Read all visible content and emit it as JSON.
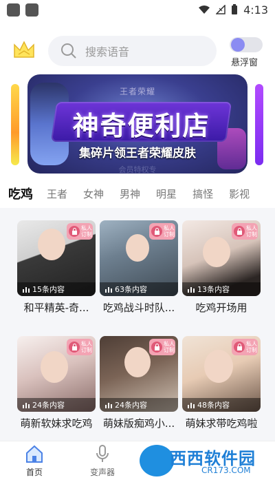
{
  "statusbar": {
    "time": "4:13"
  },
  "header": {
    "search_placeholder": "搜索语音",
    "float_label": "悬浮窗"
  },
  "banner": {
    "top_text": "王者荣耀",
    "title": "神奇便利店",
    "subtitle": "集碎片领王者荣耀皮肤",
    "bottom_text": "会员特权专"
  },
  "tabs": [
    {
      "label": "吃鸡"
    },
    {
      "label": "王者"
    },
    {
      "label": "女神"
    },
    {
      "label": "男神"
    },
    {
      "label": "明星"
    },
    {
      "label": "搞怪"
    },
    {
      "label": "影视"
    }
  ],
  "cards": [
    {
      "title": "和平精英-奇...",
      "count": "15条内容",
      "lock": "私人订制"
    },
    {
      "title": "吃鸡战斗时队...",
      "count": "63条内容",
      "lock": "私人订制"
    },
    {
      "title": "吃鸡开场用",
      "count": "13条内容",
      "lock": "私人订制"
    },
    {
      "title": "萌新软妹求吃鸡",
      "count": "24条内容",
      "lock": "私人订制"
    },
    {
      "title": "萌妹版痴鸡小...",
      "count": "24条内容",
      "lock": "私人订制"
    },
    {
      "title": "萌妹求带吃鸡啦",
      "count": "48条内容",
      "lock": "私人订制"
    }
  ],
  "nav": [
    {
      "label": "首页"
    },
    {
      "label": "变声器"
    }
  ],
  "watermark": {
    "text": "西西软件园",
    "sub": "CR173.COM"
  },
  "colors": {
    "accent": "#8b8cf2",
    "lock_bg": "#f3a3b3"
  }
}
